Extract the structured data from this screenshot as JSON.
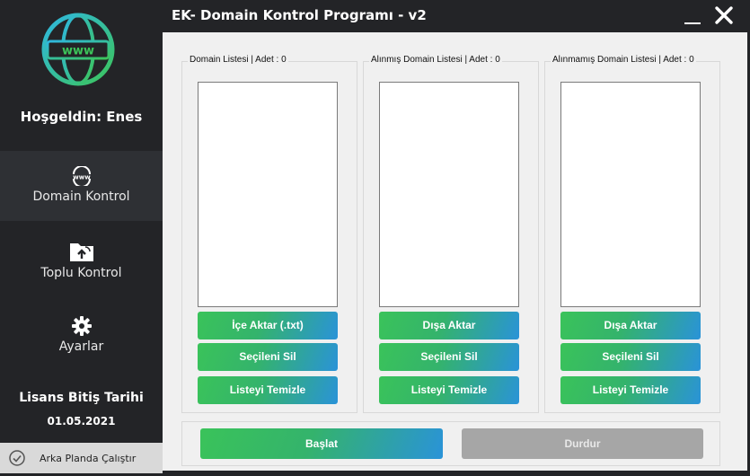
{
  "window": {
    "title": "EK- Domain Kontrol Programı - v2"
  },
  "sidebar": {
    "logo_text": "www",
    "welcome": "Hoşgeldin:  Enes",
    "items": [
      {
        "icon": "www-icon",
        "label": "Domain Kontrol",
        "active": true
      },
      {
        "icon": "folder-upload-icon",
        "label": "Toplu Kontrol",
        "active": false
      },
      {
        "icon": "gear-icon",
        "label": "Ayarlar",
        "active": false
      }
    ],
    "license_label": "Lisans Bitiş Tarihi",
    "license_date": "01.05.2021",
    "background_toggle": "Arka Planda Çalıştır"
  },
  "groups": [
    {
      "title": "Domain Listesi  |  Adet : 0",
      "buttons": [
        "İçe Aktar (.txt)",
        "Seçileni Sil",
        "Listeyi Temizle"
      ]
    },
    {
      "title": "Alınmış Domain Listesi  |  Adet : 0",
      "buttons": [
        "Dışa Aktar",
        "Seçileni Sil",
        "Listeyi Temizle"
      ]
    },
    {
      "title": "Alınmamış Domain Listesi  |  Adet : 0",
      "buttons": [
        "Dışa Aktar",
        "Seçileni Sil",
        "Listeyi Temizle"
      ]
    }
  ],
  "actions": {
    "start": "Başlat",
    "stop": "Durdur"
  },
  "colors": {
    "sidebar_bg": "#232427",
    "accent_green": "#3ac35a",
    "accent_blue": "#2a93d8",
    "disabled": "#a6a6a6"
  }
}
